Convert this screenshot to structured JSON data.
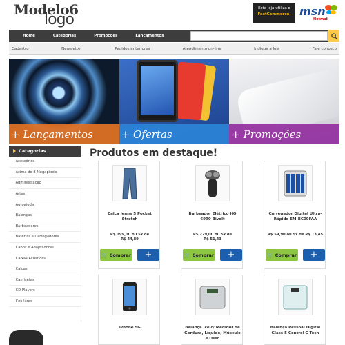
{
  "header": {
    "logo_line1": "Modelo6",
    "logo_line2": "logo",
    "fastcommerce_text": "Esta loja utiliza o",
    "fastcommerce_brand": "FastCommerce.",
    "msn_logo": "msn",
    "msn_sub": "Hotmail"
  },
  "topnav": {
    "items": [
      "Home",
      "Categorias",
      "Promoções",
      "Lançamentos"
    ]
  },
  "subnav": {
    "items": [
      "Cadastro",
      "Newsletter",
      "Pedidos anteriores",
      "Atendimento on-line",
      "Indique a loja",
      "Fale conosco"
    ]
  },
  "banners": [
    {
      "caption": "+ Lançamentos",
      "color": "#e37224"
    },
    {
      "caption": "+ Ofertas",
      "color": "#2d84d8"
    },
    {
      "caption": "+ Promoções",
      "color": "#922fa0"
    }
  ],
  "sidebar": {
    "title": "Categorias",
    "items": [
      "Acessórios",
      "Acima de 8 Megapixels",
      "Administração",
      "Artes",
      "Autoajuda",
      "Balanças",
      "Barbeadores",
      "Baterias e Carregadores",
      "Cabos e Adaptadores",
      "Caixas Acústicas",
      "Calças",
      "Camisetas",
      "CD Players",
      "Celulares"
    ]
  },
  "main": {
    "title": "Produtos em destaque!",
    "buy_label": "Comprar",
    "more_label": "+",
    "products": [
      {
        "name": "Calça Jeans 5 Pocket Stretch",
        "price_line1": "R$ 199,00 ou 5x de",
        "price_line2": "R$ 44,89",
        "icon": "jeans-icon"
      },
      {
        "name": "Barbeador Elétrico HQ 6990 Bivolt",
        "price_line1": "R$ 229,00 ou 5x de",
        "price_line2": "R$ 51,43",
        "icon": "shaver-icon"
      },
      {
        "name": "Carregador Digital Ultra-Rápido EM-BC09FAA",
        "price_line1": "R$ 59,90 ou 5x de R$ 13,45",
        "price_line2": "",
        "icon": "charger-icon"
      },
      {
        "name": "iPhone 5G",
        "price_line1": "",
        "price_line2": "",
        "icon": "iphone-icon"
      },
      {
        "name": "Balança Ice c/ Medidor de Gordura, Líquido, Músculo e Osso",
        "price_line1": "",
        "price_line2": "",
        "icon": "scale-icon"
      },
      {
        "name": "Balança Pessoal Digital Glass 5 Control G-Tech",
        "price_line1": "",
        "price_line2": "",
        "icon": "glass-scale-icon"
      }
    ]
  },
  "colors": {
    "nav_bg": "#3d3d3d",
    "accent_yellow": "#ffc94a",
    "buy_green": "#8dc63f",
    "plus_blue": "#1c5fae"
  }
}
